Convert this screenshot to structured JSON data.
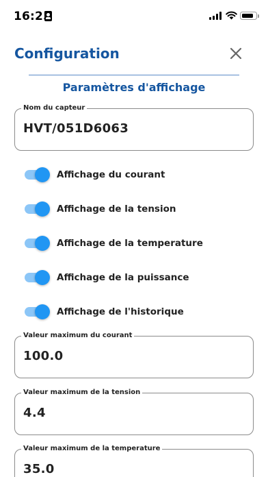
{
  "status_bar": {
    "time": "16:25",
    "battery_level": 0.85
  },
  "header": {
    "title": "Configuration"
  },
  "section": {
    "title": "Paramètres d'affichage"
  },
  "sensor_field": {
    "label": "Nom du capteur",
    "value": "HVT/051D6063"
  },
  "toggles": [
    {
      "label": "Affichage du courant",
      "on": true
    },
    {
      "label": "Affichage de la tension",
      "on": true
    },
    {
      "label": "Affichage de la temperature",
      "on": true
    },
    {
      "label": "Affichage de la puissance",
      "on": true
    },
    {
      "label": "Affichage de l'historique",
      "on": true
    }
  ],
  "max_fields": [
    {
      "label": "Valeur maximum du courant",
      "value": "100.0"
    },
    {
      "label": "Valeur maximum de la tension",
      "value": "4.4"
    },
    {
      "label": "Valeur maximum de la temperature",
      "value": "35.0"
    }
  ],
  "colors": {
    "accent": "#1556a0",
    "switch_thumb": "#2196f3",
    "switch_track": "#8cc6f7"
  }
}
